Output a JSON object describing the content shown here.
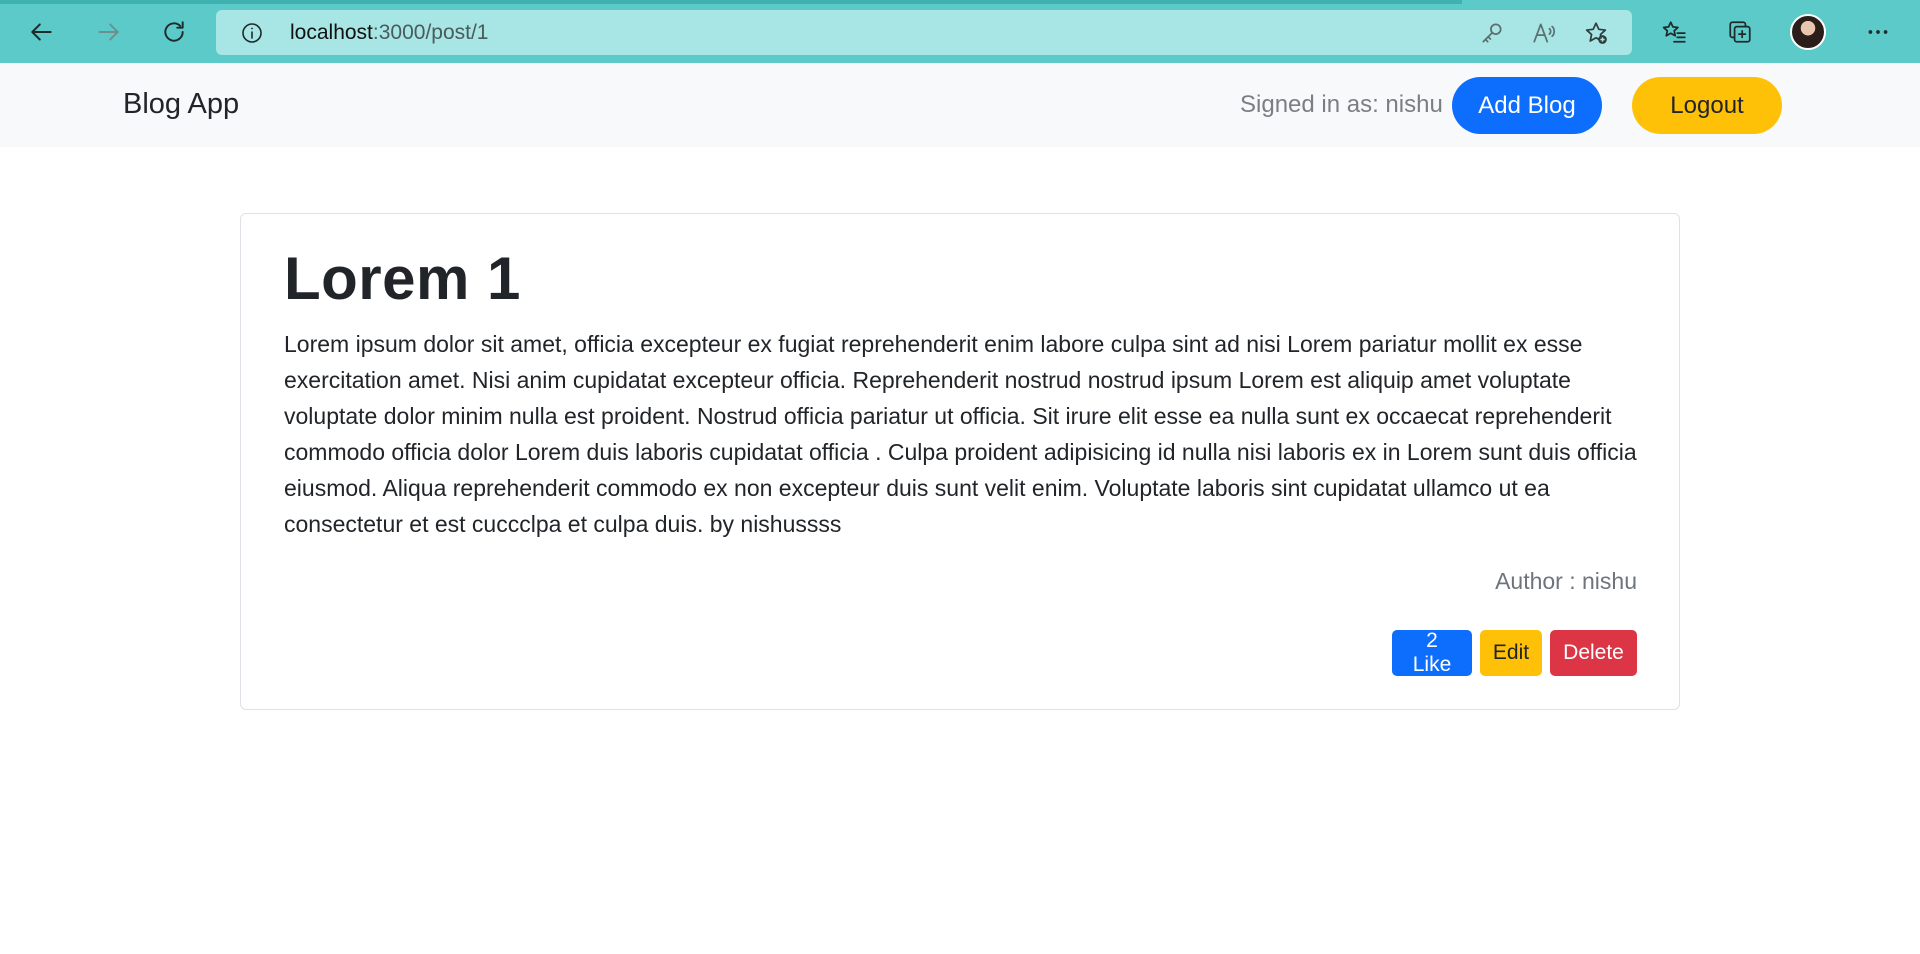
{
  "browser": {
    "url_host": "localhost",
    "url_rest": ":3000/post/1",
    "toolbar_icons": [
      "back-arrow-icon",
      "forward-arrow-icon",
      "refresh-icon",
      "info-icon",
      "key-icon",
      "read-aloud-icon",
      "add-favorite-icon",
      "favorites-icon",
      "collections-icon",
      "profile-avatar",
      "more-icon"
    ],
    "theme_color": "#5bcac8"
  },
  "navbar": {
    "brand": "Blog App",
    "signed_in_text": "Signed in as: nishu",
    "add_blog_label": "Add Blog",
    "logout_label": "Logout",
    "add_blog_color": "#0d6efd",
    "logout_color": "#ffc107"
  },
  "post": {
    "title": "Lorem 1",
    "body": "Lorem ipsum dolor sit amet, officia excepteur ex fugiat reprehenderit enim labore culpa sint ad nisi Lorem pariatur mollit ex esse exercitation amet. Nisi anim cupidatat excepteur officia. Reprehenderit nostrud nostrud ipsum Lorem est aliquip amet voluptate voluptate dolor minim nulla est proident. Nostrud officia pariatur ut officia. Sit irure elit esse ea nulla sunt ex occaecat reprehenderit commodo officia dolor Lorem duis laboris cupidatat officia . Culpa proident adipisicing id nulla nisi laboris ex in Lorem sunt duis officia eiusmod. Aliqua reprehenderit commodo ex non excepteur duis sunt velit enim. Voluptate laboris sint cupidatat ullamco ut ea consectetur et est cuccclpa et culpa duis. by nishussss",
    "author_text": "Author : nishu",
    "like_label": "2 Like",
    "edit_label": "Edit",
    "delete_label": "Delete",
    "like_color": "#0d6efd",
    "edit_color": "#ffc107",
    "delete_color": "#dc3545"
  }
}
